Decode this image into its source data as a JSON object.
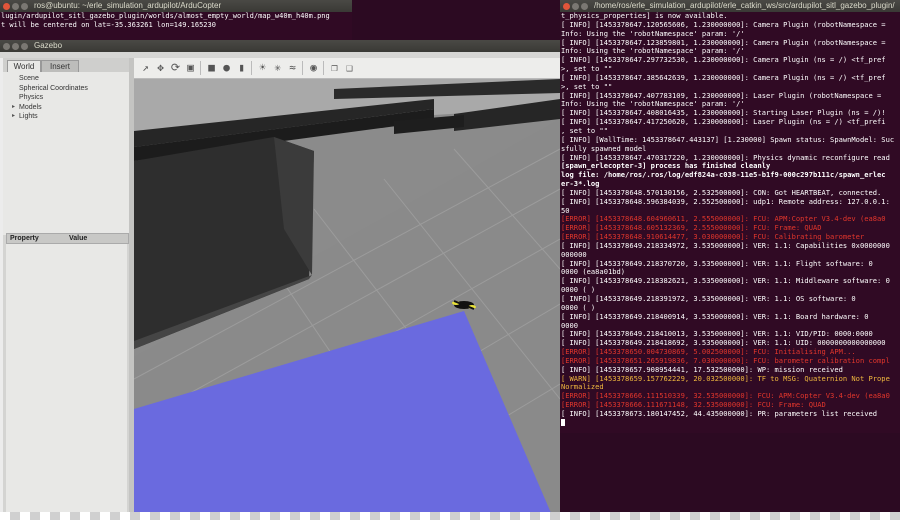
{
  "terminal_top": {
    "title": "ros@ubuntu: ~/erle_simulation_ardupilot/ArduCopter",
    "lines": [
      "lugin/ardupilot_sitl_gazebo_plugin/worlds/almost_empty_world/map_w40m_h40m.png",
      "t will be centered on lat=-35.363261 lon=149.165230"
    ]
  },
  "gazebo": {
    "title": "Gazebo",
    "tabs": [
      "World",
      "Insert"
    ],
    "tree": [
      "Scene",
      "Spherical Coordinates",
      "Physics",
      "Models",
      "Lights"
    ],
    "property_header": "Property",
    "value_header": "Value",
    "toolbar_icons": [
      "select-arrow-icon",
      "translate-icon",
      "rotate-icon",
      "scale-icon",
      "box-icon",
      "sphere-icon",
      "cylinder-icon",
      "sun-light-icon",
      "point-light-icon",
      "spot-light-icon",
      "screenshot-icon",
      "copy-icon",
      "paste-icon"
    ]
  },
  "terminal_right": {
    "title": "/home/ros/erle_simulation_ardupilot/erle_catkin_ws/src/ardupilot_sitl_gazebo_plugin/",
    "lines": [
      {
        "t": "t_physics_properties] is now available.",
        "c": "white"
      },
      {
        "t": "[ INFO] [1453378647.120565606, 1.230000000]: Camera Plugin (robotNamespace =",
        "c": "white"
      },
      {
        "t": " Info: Using the 'robotNamespace' param: '/'",
        "c": "white"
      },
      {
        "t": "[ INFO] [1453378647.123859801, 1.230000000]: Camera Plugin (robotNamespace =",
        "c": "white"
      },
      {
        "t": " Info: Using the 'robotNamespace' param: '/'",
        "c": "white"
      },
      {
        "t": "[ INFO] [1453378647.297732530, 1.230000000]: Camera Plugin (ns = /)  <tf_pref",
        "c": "white"
      },
      {
        "t": ">, set to \"\"",
        "c": "white"
      },
      {
        "t": "[ INFO] [1453378647.385642639, 1.230000000]: Camera Plugin (ns = /)  <tf_pref",
        "c": "white"
      },
      {
        "t": ">, set to \"\"",
        "c": "white"
      },
      {
        "t": "[ INFO] [1453378647.407783109, 1.230000000]: Laser Plugin (robotNamespace =",
        "c": "white"
      },
      {
        "t": "Info: Using the 'robotNamespace' param: '/'",
        "c": "white"
      },
      {
        "t": "[ INFO] [1453378647.408016435, 1.230000000]: Starting Laser Plugin (ns = /)!",
        "c": "white"
      },
      {
        "t": "[ INFO] [1453378647.417250620, 1.230000000]: Laser Plugin (ns = /)  <tf_prefi",
        "c": "white"
      },
      {
        "t": ", set to \"\"",
        "c": "white"
      },
      {
        "t": "[ INFO] [WallTime: 1453378647.443137] [1.230000] Spawn status: SpawnModel: Suc",
        "c": "white"
      },
      {
        "t": "sfully spawned model",
        "c": "white"
      },
      {
        "t": "[ INFO] [1453378647.470317220, 1.230000000]: Physics dynamic reconfigure read",
        "c": "white"
      },
      {
        "t": "[spawn_erlecopter-3] process has finished cleanly",
        "c": "bold"
      },
      {
        "t": "log file: /home/ros/.ros/log/edf824a-c038-11e5-b1f9-000c297b111c/spawn_erlec",
        "c": "bold"
      },
      {
        "t": "er-3*.log",
        "c": "bold"
      },
      {
        "t": "[ INFO] [1453378648.570130156, 2.532500000]: CON: Got HEARTBEAT, connected.",
        "c": "white"
      },
      {
        "t": "[ INFO] [1453378648.596384039, 2.552500000]: udp1: Remote address: 127.0.0.1:",
        "c": "white"
      },
      {
        "t": "50",
        "c": "white"
      },
      {
        "t": "[ERROR] [1453378648.604960611, 2.555000000]: FCU: APM:Copter V3.4-dev (ea8a0",
        "c": "err"
      },
      {
        "t": "[ERROR] [1453378648.605132369, 2.555000000]: FCU: Frame: QUAD",
        "c": "err"
      },
      {
        "t": "[ERROR] [1453378648.910614477, 3.030000000]: FCU: Calibrating barometer",
        "c": "err"
      },
      {
        "t": "[ INFO] [1453378649.218334972, 3.535000000]: VER: 1.1: Capabilities 0x0000000",
        "c": "white"
      },
      {
        "t": "000000",
        "c": "white"
      },
      {
        "t": "[ INFO] [1453378649.218370720, 3.535000000]: VER: 1.1: Flight software:     0",
        "c": "white"
      },
      {
        "t": "0000 (ea8a01bd)",
        "c": "white"
      },
      {
        "t": "[ INFO] [1453378649.218382621, 3.535000000]: VER: 1.1: Middleware software: 0",
        "c": "white"
      },
      {
        "t": "0000 (        )",
        "c": "white"
      },
      {
        "t": "[ INFO] [1453378649.218391972, 3.535000000]: VER: 1.1: OS software:        0",
        "c": "white"
      },
      {
        "t": "0000 (        )",
        "c": "white"
      },
      {
        "t": "[ INFO] [1453378649.218400914, 3.535000000]: VER: 1.1: Board hardware:      0",
        "c": "white"
      },
      {
        "t": "0000",
        "c": "white"
      },
      {
        "t": "[ INFO] [1453378649.218410013, 3.535000000]: VER: 1.1: VID/PID: 0000:0000",
        "c": "white"
      },
      {
        "t": "[ INFO] [1453378649.218418692, 3.535000000]: VER: 1.1: UID: 0000000000000000",
        "c": "white"
      },
      {
        "t": "[ERROR] [1453378650.004730869, 5.002500000]: FCU: Initialising APM...",
        "c": "err"
      },
      {
        "t": "[ERROR] [1453378651.265919836, 7.030000000]: FCU: barometer calibration compl",
        "c": "err"
      },
      {
        "t": "[ INFO] [1453378657.908954441, 17.532500000]: WP: mission received",
        "c": "white"
      },
      {
        "t": "[ WARN] [1453378659.157762229, 20.032500000]: TF to MSG: Quaternion Not Prope",
        "c": "warn"
      },
      {
        "t": "Normalized",
        "c": "warn"
      },
      {
        "t": "[ERROR] [1453378666.111510339, 32.535000000]: FCU: APM:Copter V3.4-dev (ea8a0",
        "c": "err"
      },
      {
        "t": "",
        "c": "white"
      },
      {
        "t": "[ERROR] [1453378666.111671148, 32.535000000]: FCU: Frame: QUAD",
        "c": "err"
      },
      {
        "t": "[ INFO] [1453378673.180147452, 44.435000000]: PR: parameters list received",
        "c": "white"
      }
    ]
  }
}
